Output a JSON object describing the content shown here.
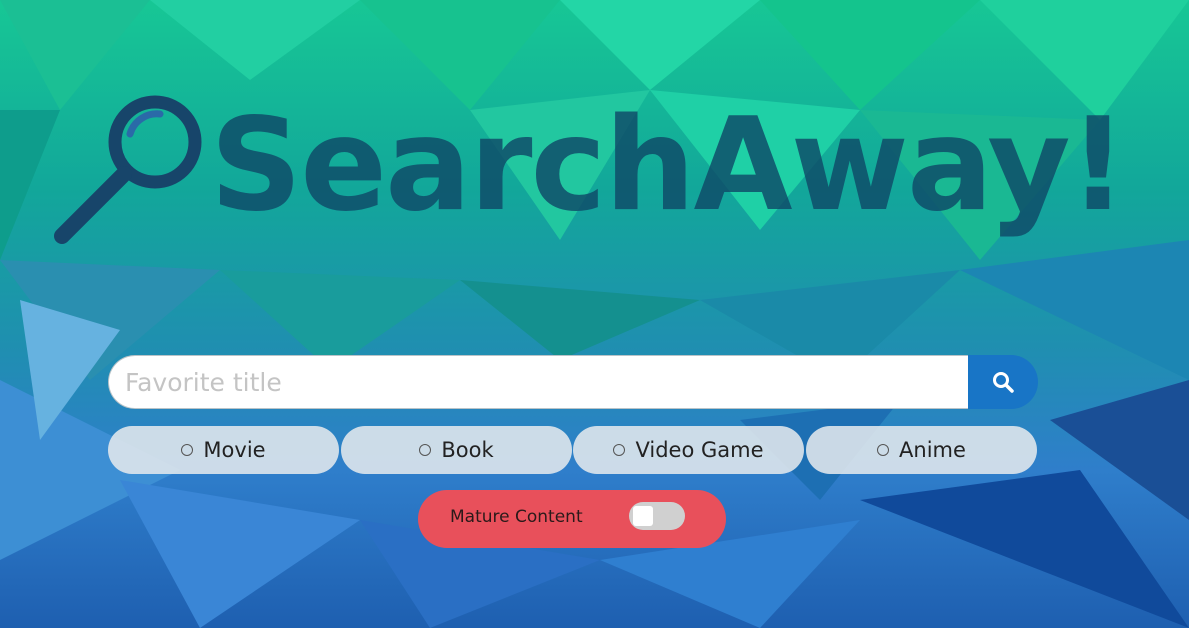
{
  "logo": {
    "title": "SearchAway!",
    "icon": "magnifier-icon"
  },
  "search": {
    "placeholder": "Favorite title",
    "value": "",
    "button_icon": "search-icon"
  },
  "types": [
    {
      "label": "Movie",
      "selected": false
    },
    {
      "label": "Book",
      "selected": false
    },
    {
      "label": "Video Game",
      "selected": false
    },
    {
      "label": "Anime",
      "selected": false
    }
  ],
  "mature": {
    "label": "Mature Content",
    "enabled": false
  },
  "colors": {
    "accent": "#1875c6",
    "mature": "#e8505b",
    "logo": "#0f4a68"
  }
}
